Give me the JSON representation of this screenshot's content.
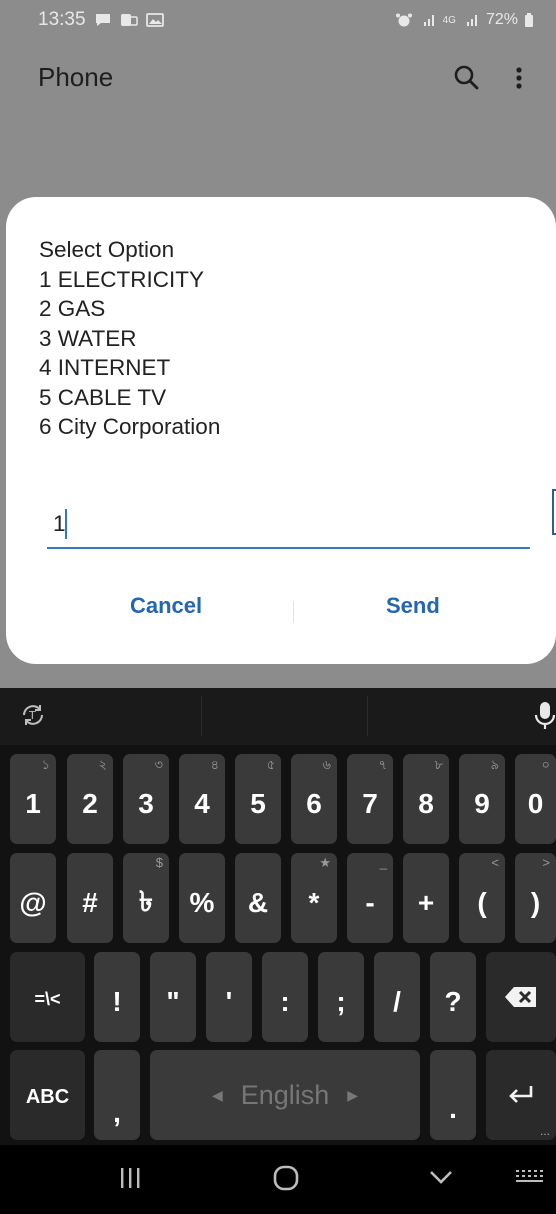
{
  "status_bar": {
    "time": "13:35",
    "battery": "72%",
    "network": "4G"
  },
  "header": {
    "title": "Phone",
    "icons": [
      "search-icon",
      "more-vert-icon"
    ]
  },
  "dialog": {
    "message": [
      "Select Option",
      "1 ELECTRICITY",
      "2 GAS",
      "3 WATER",
      "4 INTERNET",
      "5 CABLE TV",
      "6 City Corporation"
    ],
    "input_value": "1",
    "cancel_label": "Cancel",
    "send_label": "Send"
  },
  "keyboard": {
    "language": "English",
    "row1": [
      {
        "key": "1",
        "hint": "১"
      },
      {
        "key": "2",
        "hint": "২"
      },
      {
        "key": "3",
        "hint": "৩"
      },
      {
        "key": "4",
        "hint": "৪"
      },
      {
        "key": "5",
        "hint": "৫"
      },
      {
        "key": "6",
        "hint": "৬"
      },
      {
        "key": "7",
        "hint": "৭"
      },
      {
        "key": "8",
        "hint": "৮"
      },
      {
        "key": "9",
        "hint": "৯"
      },
      {
        "key": "0",
        "hint": "০"
      }
    ],
    "row2": [
      {
        "key": "@",
        "hint": ""
      },
      {
        "key": "#",
        "hint": ""
      },
      {
        "key": "৳",
        "hint": "$"
      },
      {
        "key": "%",
        "hint": ""
      },
      {
        "key": "&",
        "hint": ""
      },
      {
        "key": "*",
        "hint": "★"
      },
      {
        "key": "-",
        "hint": "_"
      },
      {
        "key": "+",
        "hint": ""
      },
      {
        "key": "(",
        "hint": "<"
      },
      {
        "key": ")",
        "hint": ">"
      }
    ],
    "row3": [
      {
        "key": "=\\<",
        "hint": ""
      },
      {
        "key": "!",
        "hint": ""
      },
      {
        "key": "\"",
        "hint": ""
      },
      {
        "key": "'",
        "hint": ""
      },
      {
        "key": ":",
        "hint": ""
      },
      {
        "key": ";",
        "hint": ""
      },
      {
        "key": "/",
        "hint": ""
      },
      {
        "key": "?",
        "hint": ""
      }
    ],
    "abc_label": "ABC",
    "comma": ",",
    "period": "."
  }
}
